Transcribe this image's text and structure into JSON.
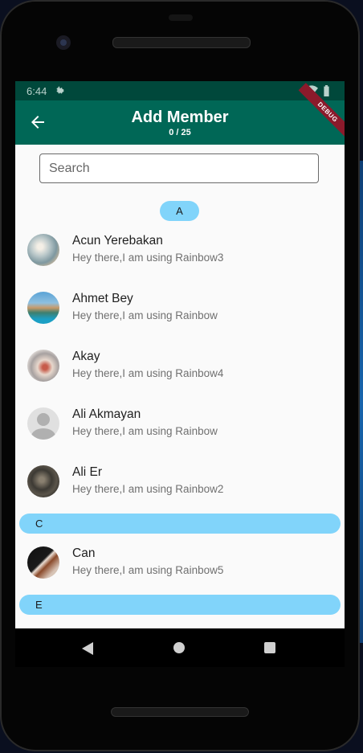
{
  "status_bar": {
    "time": "6:44"
  },
  "app_bar": {
    "title": "Add Member",
    "subtitle": "0 / 25",
    "debug_banner": "DEBUG"
  },
  "search": {
    "placeholder": "Search",
    "value": ""
  },
  "sections": [
    {
      "letter": "A",
      "members": [
        {
          "name": "Acun Yerebakan",
          "status": "Hey there,I am using Rainbow3"
        },
        {
          "name": "Ahmet Bey",
          "status": "Hey there,I am using Rainbow"
        },
        {
          "name": "Akay",
          "status": "Hey there,I am using Rainbow4"
        },
        {
          "name": "Ali Akmayan",
          "status": "Hey there,I am using Rainbow"
        },
        {
          "name": "Ali Er",
          "status": "Hey there,I am using Rainbow2"
        }
      ]
    },
    {
      "letter": "C",
      "members": [
        {
          "name": "Can",
          "status": "Hey there,I am using Rainbow5"
        }
      ]
    },
    {
      "letter": "E",
      "members": []
    }
  ],
  "icons": {
    "back": "arrow-left-icon",
    "settings": "gear-icon",
    "wifi": "wifi-icon",
    "battery": "battery-icon"
  },
  "colors": {
    "app_bar": "#006756",
    "status_bar": "#00483b",
    "section_header": "#81d4fa",
    "debug_banner": "#8b1a2b"
  }
}
